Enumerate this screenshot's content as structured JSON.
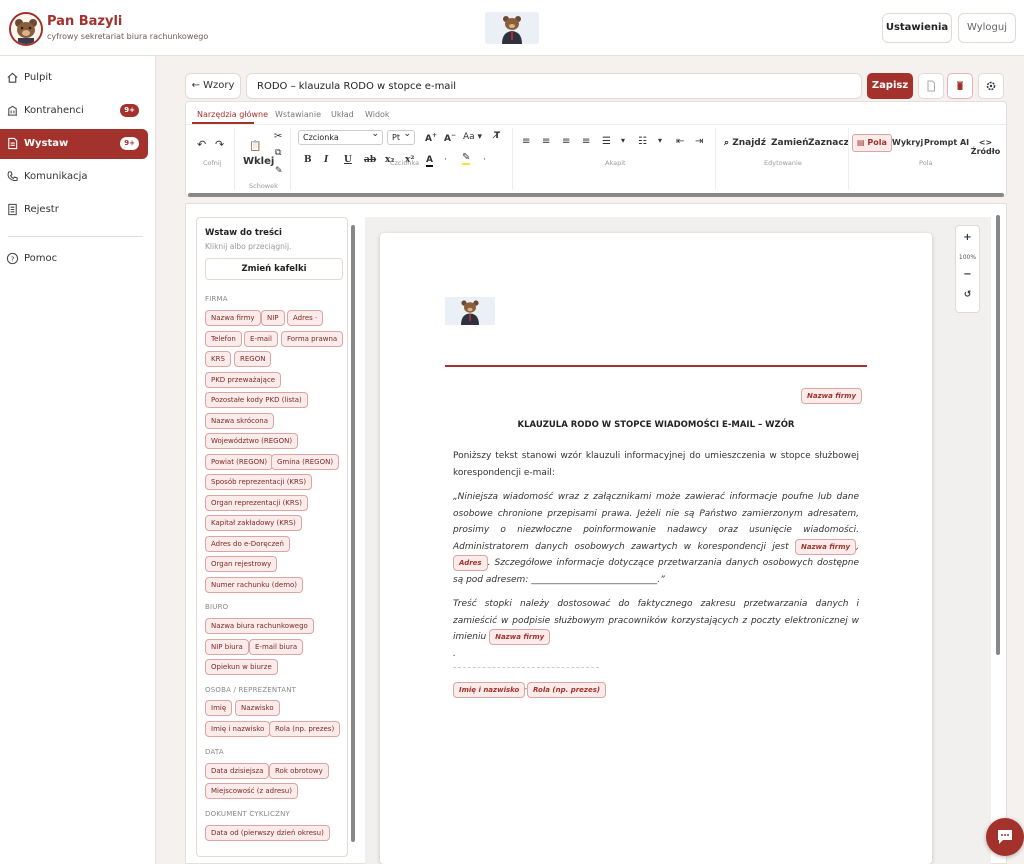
{
  "brand": {
    "title": "Pan Bazyli",
    "subtitle": "cyfrowy sekretariat biura rachunkowego"
  },
  "header": {
    "settings_label": "Ustawienia",
    "logout_label": "Wyloguj"
  },
  "sidebar": {
    "items": [
      {
        "label": "Pulpit",
        "icon": "home-icon"
      },
      {
        "label": "Kontrahenci",
        "icon": "building-icon",
        "badge": "9+"
      },
      {
        "label": "Wystaw",
        "icon": "document-icon",
        "badge": "9+",
        "active": true
      },
      {
        "label": "Komunikacja",
        "icon": "phone-icon"
      },
      {
        "label": "Rejestr",
        "icon": "register-icon"
      },
      {
        "label": "Pomoc",
        "icon": "help-icon"
      }
    ]
  },
  "toolbar": {
    "back_label": "← Wzory",
    "doc_title": "RODO – klauzula RODO w stopce e-mail",
    "save_label": "Zapisz"
  },
  "ribbon": {
    "tabs": [
      "Narzędzia główne",
      "Wstawianie",
      "Układ",
      "Widok"
    ],
    "groups": {
      "cofnij": "Cofnij",
      "schowek": "Schowek",
      "czcionka": "Czcionka",
      "akapit": "Akapit",
      "edytowanie": "Edytowanie",
      "pola": "Pola"
    },
    "paste_label": "Wklej",
    "font": "Czcionka",
    "size": "Pt",
    "case": "Aa",
    "format": {
      "bold": "B",
      "italic": "I",
      "underline": "U",
      "strike": "ab",
      "sub": "x₂",
      "sup": "x²",
      "color": "A"
    },
    "editing": {
      "find": "Znajdź",
      "replace": "Zamień",
      "select": "Zaznacz"
    },
    "fields": {
      "pola": "Pola",
      "wykryj": "Wykryj",
      "prompt": "Prompt AI",
      "source": "<> Źródło"
    }
  },
  "panel": {
    "title": "Wstaw do treści",
    "hint": "Kliknij albo przeciągnij.",
    "change_tiles": "Zmień kafelki",
    "sections": [
      {
        "title": "FIRMA",
        "chips": [
          "Nazwa firmy",
          "NIP",
          "Adres ·",
          "Telefon",
          "E-mail",
          "Forma prawna",
          "KRS",
          "REGON",
          "PKD przeważające",
          "Pozostałe kody PKD (lista)",
          "Nazwa skrócona",
          "Województwo (REGON)",
          "Powiat (REGON)",
          "Gmina (REGON)",
          "Sposób reprezentacji (KRS)",
          "Organ reprezentacji (KRS)",
          "Kapitał zakładowy (KRS)",
          "Adres do e-Doręczeń",
          "Organ rejestrowy",
          "Numer rachunku (demo)"
        ]
      },
      {
        "title": "BIURO",
        "chips": [
          "Nazwa biura rachunkowego",
          "NIP biura",
          "E-mail biura",
          "Opiekun w biurze"
        ]
      },
      {
        "title": "OSOBA / REPREZENTANT",
        "chips": [
          "Imię",
          "Nazwisko",
          "Imię i nazwisko",
          "Rola (np. prezes)"
        ]
      },
      {
        "title": "DATA",
        "chips": [
          "Data dzisiejsza",
          "Rok obrotowy",
          "Miejscowość (z adresu)"
        ]
      },
      {
        "title": "DOKUMENT CYKLICZNY",
        "chips": [
          "Data od (pierwszy dzień okresu)"
        ]
      }
    ]
  },
  "document": {
    "top_field": "Nazwa firmy",
    "heading": "KLAUZULA RODO W STOPCE WIADOMOŚCI E-MAIL – WZÓR",
    "intro": "Poniższy tekst stanowi wzór klauzuli informacyjnej do umieszczenia w stopce służbowej korespondencji e-mail:",
    "quote_a": "„Niniejsza wiadomość wraz z załącznikami może zawierać informacje poufne lub dane osobowe chronione przepisami prawa. Jeżeli nie są Państwo zamierzonym adresatem, prosimy o niezwłoczne poinformowanie nadawcy oraz usunięcie wiadomości. Administratorem danych osobowych zawartych w korespondencji jest",
    "field_firma": "Nazwa firmy",
    "sep1": ",",
    "field_adres": "Adres",
    "quote_b": ". Szczegółowe informacje dotyczące przetwarzania danych osobowych dostępne są pod adresem: ____________________________.”",
    "note": "Treść stopki należy dostosować do faktycznego zakresu przetwarzania danych i zamieścić w podpisie służbowym pracowników korzystających z poczty elektronicznej w imieniu",
    "note_field": "Nazwa firmy",
    "note_end": ".",
    "sig_name": "Imię i nazwisko",
    "sig_sep": "–",
    "sig_role": "Rola (np. prezes)"
  },
  "zoom": {
    "plus": "+",
    "level": "100%",
    "minus": "−",
    "reset": "↺"
  }
}
